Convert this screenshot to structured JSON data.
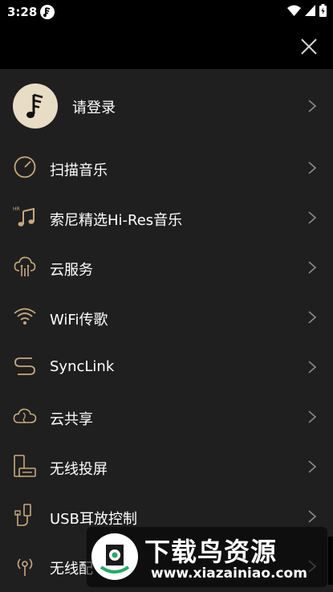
{
  "status_bar": {
    "time": "3:28"
  },
  "colors": {
    "accent": "#c8a97a",
    "background": "#1f1f1f",
    "header": "#000000"
  },
  "login": {
    "label": "请登录",
    "icon": "music-note-avatar"
  },
  "menu": {
    "items": [
      {
        "label": "扫描音乐",
        "icon": "scan-icon"
      },
      {
        "label": "索尼精选Hi-Res音乐",
        "icon": "hi-res-music-icon"
      },
      {
        "label": "云服务",
        "icon": "cloud-service-icon"
      },
      {
        "label": "WiFi传歌",
        "icon": "wifi-icon"
      },
      {
        "label": "SyncLink",
        "icon": "synclink-icon"
      },
      {
        "label": "云共享",
        "icon": "cloud-share-icon"
      },
      {
        "label": "无线投屏",
        "icon": "cast-icon"
      },
      {
        "label": "USB耳放控制",
        "icon": "usb-icon"
      },
      {
        "label": "无线配",
        "icon": "wireless-icon"
      }
    ]
  },
  "watermark": {
    "title": "下载鸟资源",
    "url": "www.xiazainiao.com"
  }
}
